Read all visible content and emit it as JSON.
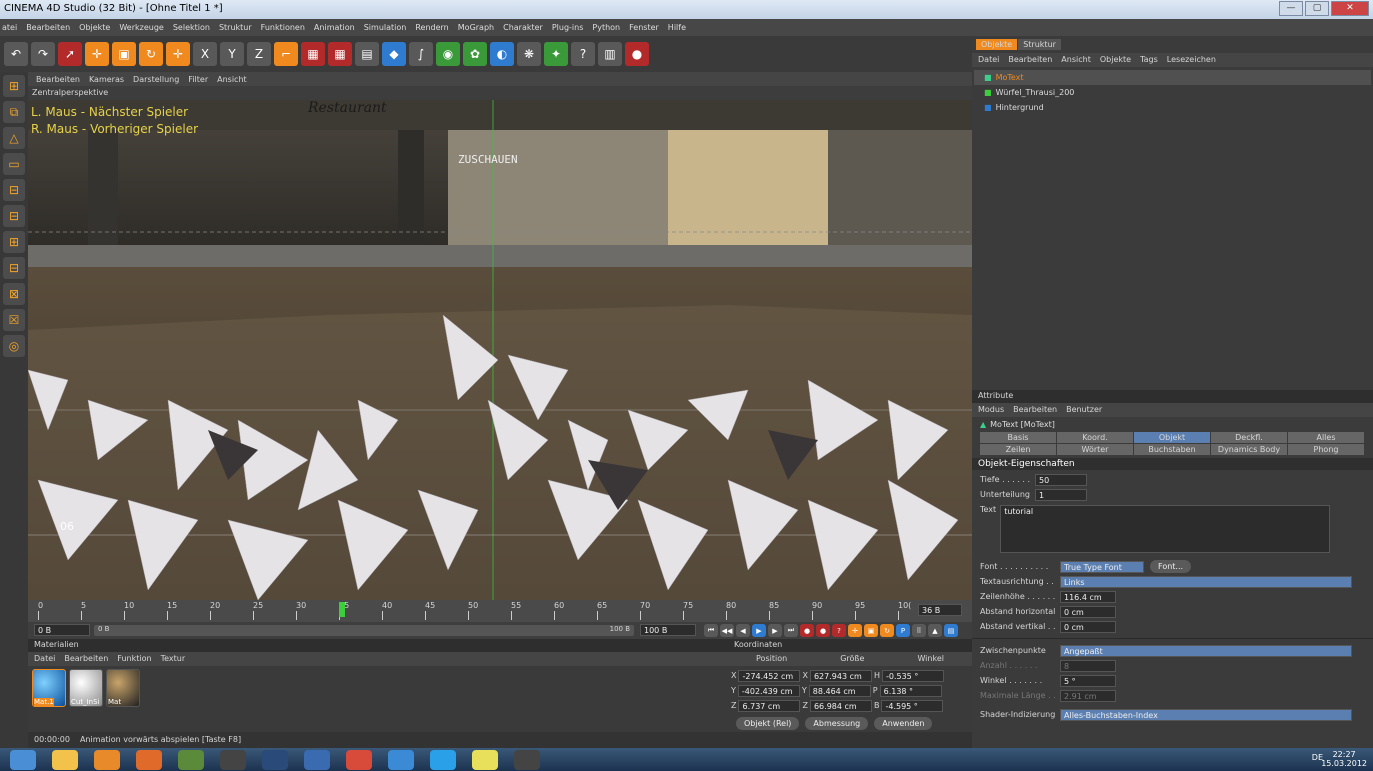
{
  "window": {
    "title": "CINEMA 4D Studio (32 Bit) - [Ohne Titel 1 *]",
    "minimize": "—",
    "maximize": "▢",
    "close": "✕"
  },
  "menu": [
    "atei",
    "Bearbeiten",
    "Objekte",
    "Werkzeuge",
    "Selektion",
    "Struktur",
    "Funktionen",
    "Animation",
    "Simulation",
    "Rendern",
    "MoGraph",
    "Charakter",
    "Plug-ins",
    "Python",
    "Fenster",
    "Hilfe"
  ],
  "toolbar": [
    {
      "icon": "undo-icon",
      "glyph": "↶",
      "c": ""
    },
    {
      "icon": "redo-icon",
      "glyph": "↷",
      "c": ""
    },
    {
      "icon": "select-icon",
      "glyph": "➚",
      "c": "r"
    },
    {
      "icon": "move-icon",
      "glyph": "✛",
      "c": "o"
    },
    {
      "icon": "scale-icon",
      "glyph": "▣",
      "c": "o"
    },
    {
      "icon": "rotate-icon",
      "glyph": "↻",
      "c": "o"
    },
    {
      "icon": "add-icon",
      "glyph": "✛",
      "c": "o"
    },
    {
      "icon": "x-axis-icon",
      "glyph": "X",
      "c": ""
    },
    {
      "icon": "y-axis-icon",
      "glyph": "Y",
      "c": ""
    },
    {
      "icon": "z-axis-icon",
      "glyph": "Z",
      "c": ""
    },
    {
      "icon": "coord-icon",
      "glyph": "⌐",
      "c": "o"
    },
    {
      "icon": "render-view-icon",
      "glyph": "▦",
      "c": "r"
    },
    {
      "icon": "render-picture-icon",
      "glyph": "▦",
      "c": "r"
    },
    {
      "icon": "render-settings-icon",
      "glyph": "▤",
      "c": ""
    },
    {
      "icon": "cube-icon",
      "glyph": "◆",
      "c": "b"
    },
    {
      "icon": "spline-icon",
      "glyph": "∫",
      "c": ""
    },
    {
      "icon": "nurbs-icon",
      "glyph": "◉",
      "c": "g"
    },
    {
      "icon": "array-icon",
      "glyph": "✿",
      "c": "g"
    },
    {
      "icon": "deformer-icon",
      "glyph": "◐",
      "c": "b"
    },
    {
      "icon": "scene-icon",
      "glyph": "❋",
      "c": ""
    },
    {
      "icon": "light-icon",
      "glyph": "✦",
      "c": "g"
    },
    {
      "icon": "help-icon",
      "glyph": "?",
      "c": ""
    },
    {
      "icon": "layout-icon",
      "glyph": "▥",
      "c": ""
    },
    {
      "icon": "record-icon",
      "glyph": "●",
      "c": "r"
    }
  ],
  "left_tools": [
    "⊞",
    "⧉",
    "△",
    "▭",
    "⊟",
    "⊟",
    "⊞",
    "⊟",
    "⊠",
    "☒",
    "◎"
  ],
  "viewport": {
    "menu": [
      "Bearbeiten",
      "Kameras",
      "Darstellung",
      "Filter",
      "Ansicht"
    ],
    "title": "Zentralperspektive",
    "hint1": "L. Maus - Nächster Spieler",
    "hint2": "R. Maus - Vorheriger Spieler",
    "sign": "ZUSCHAUEN",
    "restaurant": "Restaurant",
    "frame_label": "06"
  },
  "timeline": {
    "ticks": [
      "0",
      "5",
      "10",
      "15",
      "20",
      "25",
      "30",
      "35",
      "40",
      "45",
      "50",
      "55",
      "60",
      "65",
      "70",
      "75",
      "80",
      "85",
      "90",
      "95",
      "10("
    ],
    "current_frame": "36 B",
    "start": "0 B",
    "range_start": "0 B",
    "range_end": "100 B",
    "end": "100 B",
    "playhead_frame": 35,
    "max_frame": 100
  },
  "materials": {
    "title": "Materialien",
    "menu": [
      "Datei",
      "Bearbeiten",
      "Funktion",
      "Textur"
    ],
    "items": [
      "Mat.1",
      "Cut_InSi",
      "Mat"
    ]
  },
  "coords": {
    "title": "Koordinaten",
    "headers": [
      "Position",
      "Größe",
      "Winkel"
    ],
    "rows": [
      [
        "X",
        "-274.452 cm",
        "X",
        "627.943 cm",
        "H",
        "-0.535 °"
      ],
      [
        "Y",
        "-402.439 cm",
        "Y",
        "88.464 cm",
        "P",
        "6.138 °"
      ],
      [
        "Z",
        "6.737 cm",
        "Z",
        "66.984 cm",
        "B",
        "-4.595 °"
      ]
    ],
    "mode": "Objekt (Rel)",
    "size_mode": "Abmessung",
    "apply": "Anwenden"
  },
  "status": {
    "time": "00:00:00",
    "text": "Animation vorwärts abspielen [Taste F8]"
  },
  "objects": {
    "tabs": [
      "Objekte",
      "Struktur"
    ],
    "menu": [
      "Datei",
      "Bearbeiten",
      "Ansicht",
      "Objekte",
      "Tags",
      "Lesezeichen"
    ],
    "items": [
      "MoText",
      "Würfel_Thrausi_200",
      "Hintergrund"
    ]
  },
  "attributes": {
    "title": "Attribute",
    "menu": [
      "Modus",
      "Bearbeiten",
      "Benutzer"
    ],
    "object": "MoText [MoText]",
    "tabs_row1": [
      "Basis",
      "Koord.",
      "Objekt",
      "Deckfl.",
      "Alles"
    ],
    "tabs_row2": [
      "Zeilen",
      "Wörter",
      "Buchstaben",
      "Dynamics Body",
      "Phong"
    ],
    "section": "Objekt-Eigenschaften",
    "tiefe_label": "Tiefe . . . . . .",
    "tiefe": "50",
    "unterteilung_label": "Unterteilung",
    "unterteilung": "1",
    "text_label": "Text",
    "text": "tutorial",
    "font_label": "Font . . . . . . . . . .",
    "font": "True Type Font",
    "font_btn": "Font...",
    "ausrichtung_label": "Textausrichtung . .",
    "ausrichtung": "Links",
    "zeilenhoehe_label": "Zeilenhöhe . . . . . .",
    "zeilenhoehe": "116.4 cm",
    "abst_h_label": "Abstand horizontal",
    "abst_h": "0 cm",
    "abst_v_label": "Abstand vertikal . .",
    "abst_v": "0 cm",
    "zwischen_label": "Zwischenpunkte",
    "zwischen": "Angepaßt",
    "anzahl_label": "Anzahl . . . . . .",
    "anzahl": "8",
    "winkel_label": "Winkel . . . . . . .",
    "winkel": "5 °",
    "maxlaenge_label": "Maximale Länge . .",
    "maxlaenge": "2.91 cm",
    "shader_label": "Shader-Indizierung",
    "shader": "Alles-Buchstaben-Index"
  },
  "taskbar": {
    "apps": [
      "windows",
      "explorer",
      "media",
      "firefox",
      "minecraft",
      "ae",
      "c4d",
      "c4d2",
      "chrome",
      "app",
      "skype",
      "notes",
      "app2"
    ],
    "lang": "DE",
    "clock": "22:27",
    "date": "15.03.2012"
  },
  "colors": {
    "accent": "#f08a1e",
    "selected": "#5a7fb0"
  }
}
